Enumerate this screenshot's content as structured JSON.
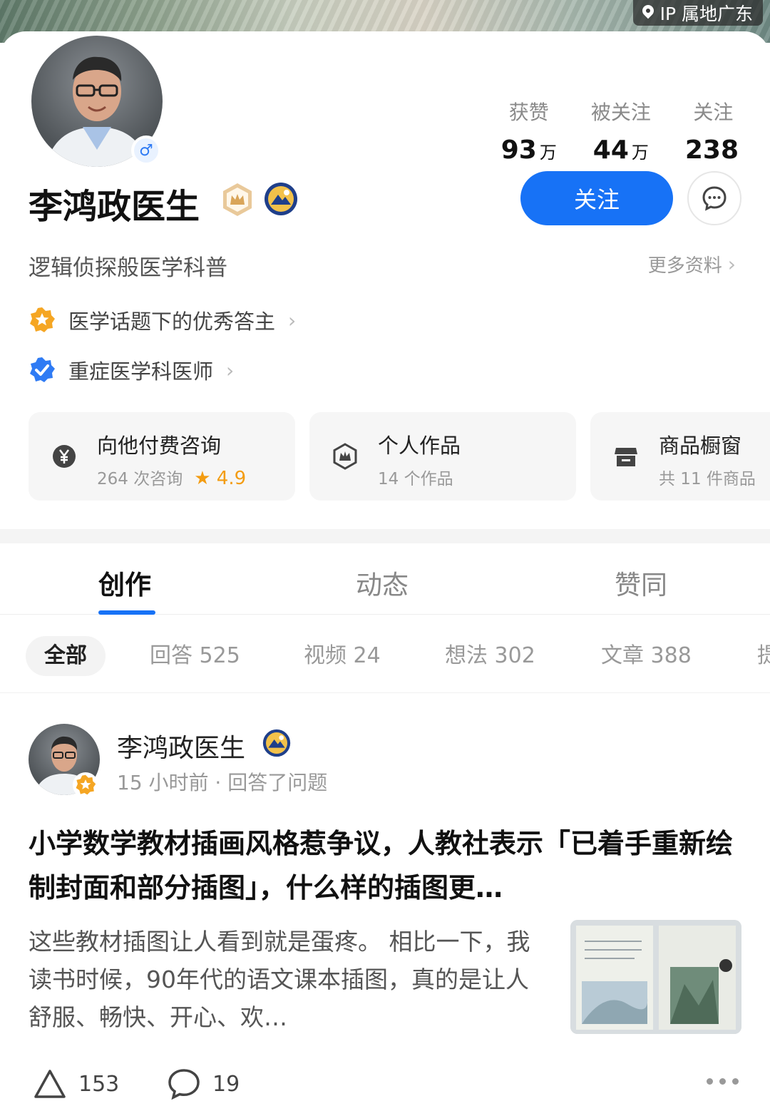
{
  "header": {
    "ip_location": "IP 属地广东"
  },
  "profile": {
    "name": "李鸿政医生",
    "bio": "逻辑侦探般医学科普",
    "more_info": "更多资料",
    "stats": [
      {
        "label": "获赞",
        "value": "93",
        "unit": "万"
      },
      {
        "label": "被关注",
        "value": "44",
        "unit": "万"
      },
      {
        "label": "关注",
        "value": "238",
        "unit": ""
      }
    ],
    "follow_label": "关注",
    "honors": [
      {
        "text": "医学话题下的优秀答主",
        "icon": "star-badge-icon"
      },
      {
        "text": "重症医学科医师",
        "icon": "verified-check-icon"
      }
    ]
  },
  "services": [
    {
      "title": "向他付费咨询",
      "subtitle": "264 次咨询",
      "rating": "★ 4.9",
      "icon": "yen-icon"
    },
    {
      "title": "个人作品",
      "subtitle": "14 个作品",
      "icon": "works-icon"
    },
    {
      "title": "商品橱窗",
      "subtitle": "共 11 件商品",
      "icon": "shop-icon"
    }
  ],
  "tabs": [
    "创作",
    "动态",
    "赞同"
  ],
  "filters": [
    "全部",
    "回答 525",
    "视频 24",
    "想法 302",
    "文章 388",
    "提"
  ],
  "post": {
    "author": "李鸿政医生",
    "meta": "15 小时前 · 回答了问题",
    "title": "小学数学教材插画风格惹争议，人教社表示「已着手重新绘制封面和部分插图」，什么样的插图更…",
    "excerpt": "这些教材插图让人看到就是蛋疼。 相比一下，我读书时候，90年代的语文课本插图，真的是让人舒服、畅快、开心、欢…",
    "likes": "153",
    "comments": "19"
  },
  "colors": {
    "accent": "#1772f6",
    "gold": "#f39c12"
  }
}
